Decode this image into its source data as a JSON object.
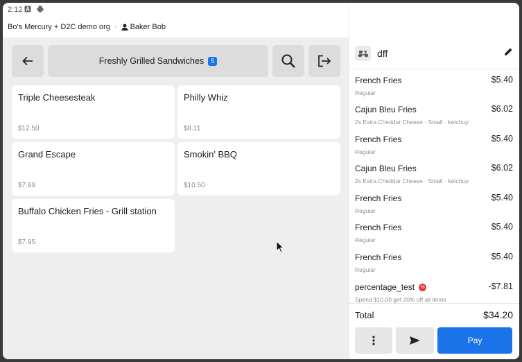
{
  "status": {
    "time": "2:12"
  },
  "org": {
    "name": "Bo's Mercury + D2C demo org",
    "separator": "·",
    "user": "Baker Bob"
  },
  "category": {
    "label": "Freshly Grilled Sandwiches",
    "count": "5"
  },
  "products": [
    {
      "name": "Triple Cheesesteak",
      "price": "$12.50"
    },
    {
      "name": "Philly Whiz",
      "price": "$8.11"
    },
    {
      "name": "Grand Escape",
      "price": "$7.99"
    },
    {
      "name": "Smokin' BBQ",
      "price": "$10.50"
    },
    {
      "name": "Buffalo Chicken Fries - Grill station",
      "price": "$7.95"
    }
  ],
  "ticket": {
    "name": "dff",
    "lines": [
      {
        "name": "French Fries",
        "price": "$5.40",
        "desc": "Regular"
      },
      {
        "name": "Cajun Bleu Fries",
        "price": "$6.02",
        "desc": "2x Extra Cheddar Cheese · Small · ketchup"
      },
      {
        "name": "French Fries",
        "price": "$5.40",
        "desc": "Regular"
      },
      {
        "name": "Cajun Bleu Fries",
        "price": "$6.02",
        "desc": "2x Extra Cheddar Cheese · Small · ketchup"
      },
      {
        "name": "French Fries",
        "price": "$5.40",
        "desc": "Regular"
      },
      {
        "name": "French Fries",
        "price": "$5.40",
        "desc": "Regular"
      },
      {
        "name": "French Fries",
        "price": "$5.40",
        "desc": "Regular"
      },
      {
        "name": "percentage_test",
        "price": "-$7.81",
        "desc": "Spend $10.00 get 20% off all items"
      }
    ],
    "total_label": "Total",
    "total_value": "$34.20",
    "pay_label": "Pay"
  },
  "colors": {
    "accent": "#1a73e8",
    "discount": "#e53935"
  }
}
